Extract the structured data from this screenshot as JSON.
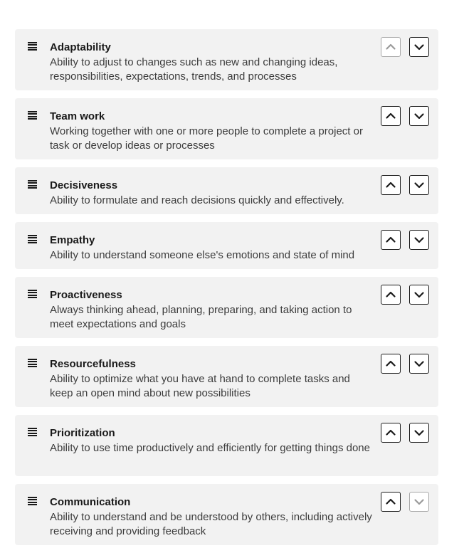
{
  "items": [
    {
      "title": "Adaptability",
      "description": "Ability to adjust to changes such as new and changing ideas, responsibilities, expectations, trends, and processes"
    },
    {
      "title": "Team work",
      "description": "Working together with one or more people to complete a project or task or develop ideas or processes"
    },
    {
      "title": "Decisiveness",
      "description": "Ability to formulate and reach decisions quickly and effectively."
    },
    {
      "title": "Empathy",
      "description": "Ability to understand someone else's emotions and state of mind"
    },
    {
      "title": "Proactiveness",
      "description": "Always thinking ahead, planning, preparing, and taking action to meet expectations and goals"
    },
    {
      "title": "Resourcefulness",
      "description": "Ability to optimize what you have at hand to complete tasks and keep an open mind about new possibilities"
    },
    {
      "title": "Prioritization",
      "description": "Ability to use time productively and efficiently for getting things done"
    },
    {
      "title": "Communication",
      "description": "Ability to understand and be understood by others, including actively receiving  and providing feedback"
    }
  ],
  "icons": {
    "drag": "drag-handle-icon",
    "up": "chevron-up-icon",
    "down": "chevron-down-icon"
  },
  "colors": {
    "card_background": "#f2f2f2",
    "button_border": "#1a1a1a",
    "disabled_border": "#a8a8a8"
  }
}
